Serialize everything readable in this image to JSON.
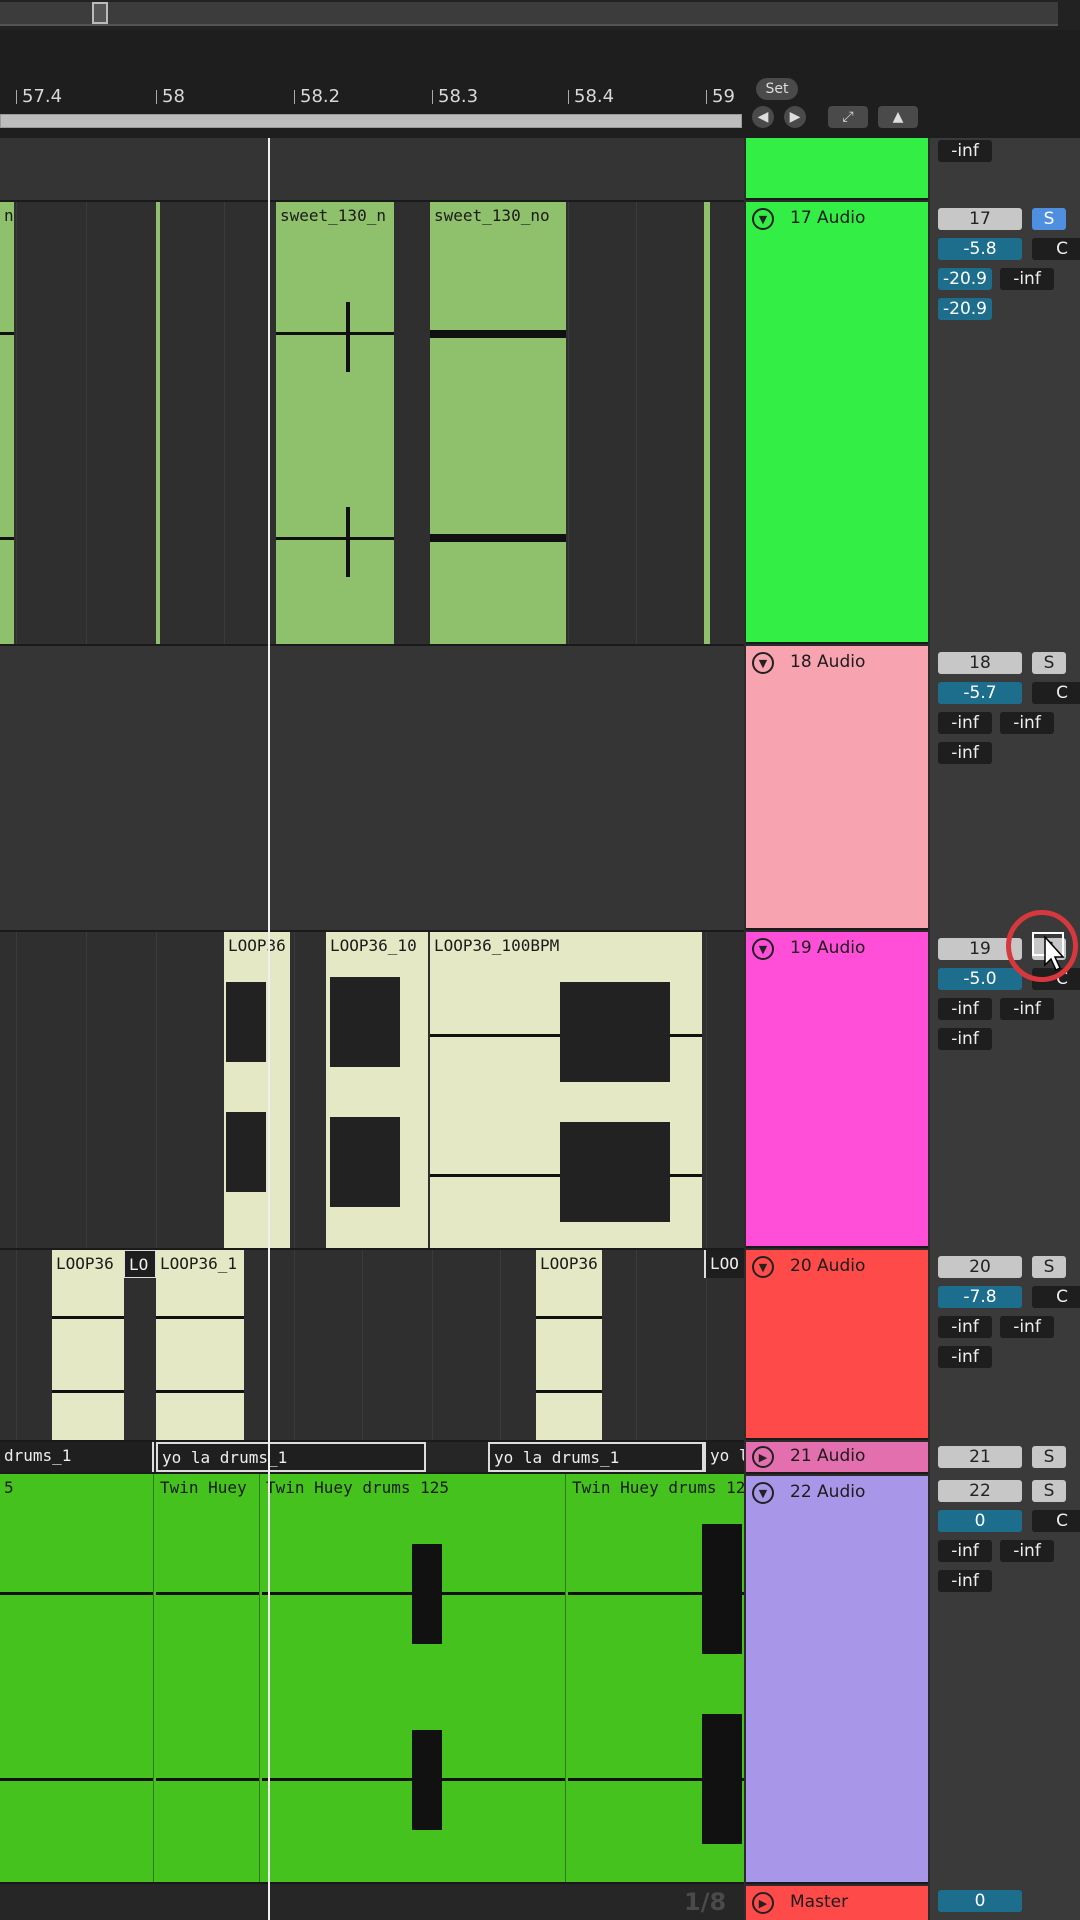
{
  "ruler": {
    "bars": [
      "57.4",
      "58",
      "58.2",
      "58.3",
      "58.4",
      "59"
    ],
    "set_label": "Set"
  },
  "tracks": [
    {
      "name": "17 Audio",
      "color": "#33ee44",
      "number": "17",
      "volume": "-5.8",
      "sends": [
        "-20.9",
        "-inf"
      ],
      "extra": "-20.9",
      "solo": "S",
      "solo_active": true
    },
    {
      "name": "18 Audio",
      "color": "#f7a3b0",
      "number": "18",
      "volume": "-5.7",
      "sends": [
        "-inf",
        "-inf"
      ],
      "extra": "-inf",
      "solo": "S",
      "solo_active": false
    },
    {
      "name": "19 Audio",
      "color": "#ff4fd8",
      "number": "19",
      "volume": "-5.0",
      "sends": [
        "-inf",
        "-inf"
      ],
      "extra": "-inf",
      "solo": "S",
      "solo_active": false
    },
    {
      "name": "20 Audio",
      "color": "#ff4a4a",
      "number": "20",
      "volume": "-7.8",
      "sends": [
        "-inf",
        "-inf"
      ],
      "extra": "-inf",
      "solo": "S",
      "solo_active": false
    },
    {
      "name": "21 Audio",
      "color": "#e46fae",
      "number": "21",
      "solo": "S",
      "solo_active": false
    },
    {
      "name": "22 Audio",
      "color": "#a897e8",
      "number": "22",
      "volume": "0",
      "sends": [
        "-inf",
        "-inf"
      ],
      "extra": "-inf",
      "solo": "S",
      "solo_active": false
    },
    {
      "name": "Master",
      "color": "#ff4a4a",
      "number": "0"
    }
  ],
  "top_value": "-inf",
  "c_label": "C",
  "clips": {
    "t17": [
      "no",
      "sweet_130_n",
      "sweet_130_no"
    ],
    "t19": [
      "LOOP36",
      "LOOP36_10",
      "LOOP36_100BPM"
    ],
    "t20": [
      "LOOP36",
      "LO",
      "LOOP36_1",
      "LOOP36",
      "LOO"
    ],
    "t21": [
      "drums_1",
      "yo la drums_1",
      "yo la drums_1",
      "yo la"
    ],
    "t22": [
      "5",
      "Twin Huey",
      "Twin Huey drums 125",
      "Twin Huey drums 12"
    ]
  },
  "bottom_fraction": "1/8"
}
